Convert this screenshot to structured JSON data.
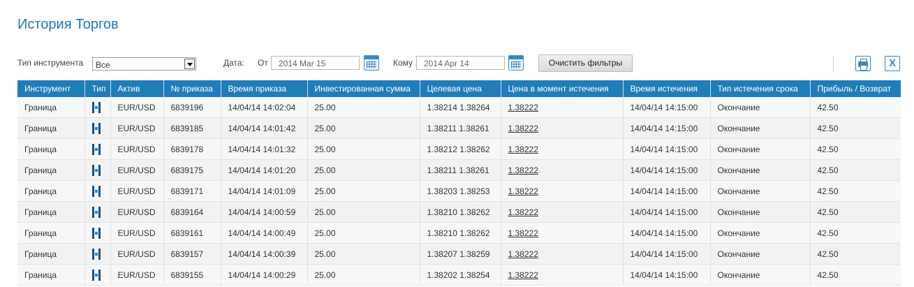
{
  "page": {
    "title": "История Торгов"
  },
  "filters": {
    "instrument_label": "Тип инструмента",
    "instrument_value": "Все",
    "date_label": "Дата:",
    "from_label": "От",
    "from_value": "2014 Mar 15",
    "to_label": "Кому",
    "to_value": "2014 Apr 14",
    "clear_label": "Очистить фильтры"
  },
  "toolbar": {
    "icons": [
      "print-icon",
      "excel-icon"
    ]
  },
  "colors": {
    "accent": "#1f7dba",
    "title": "#1a78b8"
  },
  "table": {
    "columns": [
      "Инструмент",
      "Тип",
      "Актив",
      "№ приказа",
      "Время приказа",
      "Инвестированная сумма",
      "Целевая цена",
      "Цена в момент истечения",
      "Время истечения",
      "Тип истечения срока",
      "Прибыль / Возврат"
    ],
    "rows": [
      {
        "instrument": "Граница",
        "asset": "EUR/USD",
        "order": "6839196",
        "order_time": "14/04/14 14:02:04",
        "amount": "25.00",
        "target": "1.38214 1.38264",
        "expiry_price": "1.38222",
        "expiry_time": "14/04/14 14:15:00",
        "expiry_type": "Окончание",
        "profit": "42.50"
      },
      {
        "instrument": "Граница",
        "asset": "EUR/USD",
        "order": "6839185",
        "order_time": "14/04/14 14:01:42",
        "amount": "25.00",
        "target": "1.38211 1.38261",
        "expiry_price": "1.38222",
        "expiry_time": "14/04/14 14:15:00",
        "expiry_type": "Окончание",
        "profit": "42.50"
      },
      {
        "instrument": "Граница",
        "asset": "EUR/USD",
        "order": "6839178",
        "order_time": "14/04/14 14:01:32",
        "amount": "25.00",
        "target": "1.38212 1.38262",
        "expiry_price": "1.38222",
        "expiry_time": "14/04/14 14:15:00",
        "expiry_type": "Окончание",
        "profit": "42.50"
      },
      {
        "instrument": "Граница",
        "asset": "EUR/USD",
        "order": "6839175",
        "order_time": "14/04/14 14:01:20",
        "amount": "25.00",
        "target": "1.38211 1.38261",
        "expiry_price": "1.38222",
        "expiry_time": "14/04/14 14:15:00",
        "expiry_type": "Окончание",
        "profit": "42.50"
      },
      {
        "instrument": "Граница",
        "asset": "EUR/USD",
        "order": "6839171",
        "order_time": "14/04/14 14:01:09",
        "amount": "25.00",
        "target": "1.38203 1.38253",
        "expiry_price": "1.38222",
        "expiry_time": "14/04/14 14:15:00",
        "expiry_type": "Окончание",
        "profit": "42.50"
      },
      {
        "instrument": "Граница",
        "asset": "EUR/USD",
        "order": "6839164",
        "order_time": "14/04/14 14:00:59",
        "amount": "25.00",
        "target": "1.38210 1.38262",
        "expiry_price": "1.38222",
        "expiry_time": "14/04/14 14:15:00",
        "expiry_type": "Окончание",
        "profit": "42.50"
      },
      {
        "instrument": "Граница",
        "asset": "EUR/USD",
        "order": "6839161",
        "order_time": "14/04/14 14:00:49",
        "amount": "25.00",
        "target": "1.38210 1.38262",
        "expiry_price": "1.38222",
        "expiry_time": "14/04/14 14:15:00",
        "expiry_type": "Окончание",
        "profit": "42.50"
      },
      {
        "instrument": "Граница",
        "asset": "EUR/USD",
        "order": "6839157",
        "order_time": "14/04/14 14:00:39",
        "amount": "25.00",
        "target": "1.38207 1.38259",
        "expiry_price": "1.38222",
        "expiry_time": "14/04/14 14:15:00",
        "expiry_type": "Окончание",
        "profit": "42.50"
      },
      {
        "instrument": "Граница",
        "asset": "EUR/USD",
        "order": "6839155",
        "order_time": "14/04/14 14:00:29",
        "amount": "25.00",
        "target": "1.38202 1.38254",
        "expiry_price": "1.38222",
        "expiry_time": "14/04/14 14:15:00",
        "expiry_type": "Окончание",
        "profit": "42.50"
      }
    ]
  }
}
